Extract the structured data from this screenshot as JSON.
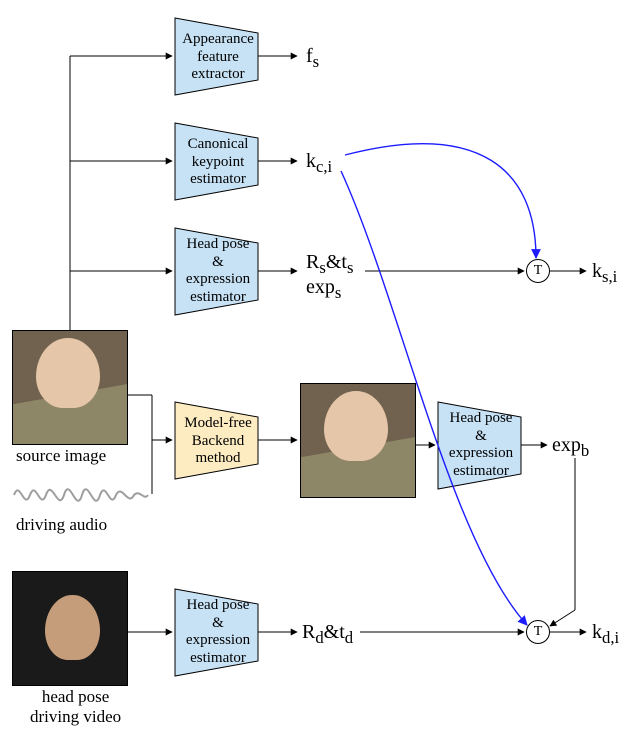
{
  "inputs": {
    "source_image_caption": "source image",
    "driving_audio_caption": "driving audio",
    "head_pose_driving_video_caption": "head pose\ndriving video"
  },
  "modules": {
    "appearance": "Appearance\nfeature\nextractor",
    "canonical": "Canonical\nkeypoint\nestimator",
    "pose_expr_top": "Head pose\n&\nexpression\nestimator",
    "backend": "Model-free\nBackend\nmethod",
    "pose_expr_mid": "Head pose\n&\nexpression\nestimator",
    "pose_expr_bot": "Head pose\n&\nexpression\nestimator"
  },
  "ops": {
    "T1": "T",
    "T2": "T"
  },
  "vars": {
    "fs": "f_s",
    "kci": "k_{c,i}",
    "Rs_ts": "R_s & t_s",
    "exps": "exp_s",
    "expb": "exp_b",
    "Rd_td": "R_d & t_d",
    "ksi": "k_{s,i}",
    "kdi": "k_{d,i}"
  },
  "chart_data": {
    "type": "diagram",
    "title": "",
    "nodes": [
      {
        "id": "source_image",
        "type": "input",
        "label": "source image"
      },
      {
        "id": "driving_audio",
        "type": "input",
        "label": "driving audio"
      },
      {
        "id": "head_pose_video",
        "type": "input",
        "label": "head pose driving video"
      },
      {
        "id": "appearance_extractor",
        "type": "module",
        "label": "Appearance feature extractor",
        "color": "#c7e2f5"
      },
      {
        "id": "canonical_kp",
        "type": "module",
        "label": "Canonical keypoint estimator",
        "color": "#c7e2f5"
      },
      {
        "id": "pose_expr_src",
        "type": "module",
        "label": "Head pose & expression estimator",
        "color": "#c7e2f5"
      },
      {
        "id": "backend",
        "type": "module",
        "label": "Model-free Backend method",
        "color": "#fdecc2"
      },
      {
        "id": "generated_frame",
        "type": "intermediate",
        "label": "generated frame"
      },
      {
        "id": "pose_expr_gen",
        "type": "module",
        "label": "Head pose & expression estimator",
        "color": "#c7e2f5"
      },
      {
        "id": "pose_expr_hpv",
        "type": "module",
        "label": "Head pose & expression estimator",
        "color": "#c7e2f5"
      },
      {
        "id": "T_top",
        "type": "op",
        "label": "T"
      },
      {
        "id": "T_bot",
        "type": "op",
        "label": "T"
      },
      {
        "id": "f_s",
        "type": "var",
        "label": "f_s"
      },
      {
        "id": "k_ci",
        "type": "var",
        "label": "k_{c,i}"
      },
      {
        "id": "Rs_ts",
        "type": "var",
        "label": "R_s & t_s"
      },
      {
        "id": "exp_s",
        "type": "var",
        "label": "exp_s"
      },
      {
        "id": "exp_b",
        "type": "var",
        "label": "exp_b"
      },
      {
        "id": "Rd_td",
        "type": "var",
        "label": "R_d & t_d"
      },
      {
        "id": "k_si",
        "type": "output",
        "label": "k_{s,i}"
      },
      {
        "id": "k_di",
        "type": "output",
        "label": "k_{d,i}"
      }
    ],
    "edges": [
      {
        "from": "source_image",
        "to": "appearance_extractor"
      },
      {
        "from": "source_image",
        "to": "canonical_kp"
      },
      {
        "from": "source_image",
        "to": "pose_expr_src"
      },
      {
        "from": "source_image",
        "to": "backend"
      },
      {
        "from": "driving_audio",
        "to": "backend"
      },
      {
        "from": "appearance_extractor",
        "to": "f_s"
      },
      {
        "from": "canonical_kp",
        "to": "k_ci"
      },
      {
        "from": "pose_expr_src",
        "to": "Rs_ts"
      },
      {
        "from": "pose_expr_src",
        "to": "exp_s"
      },
      {
        "from": "backend",
        "to": "generated_frame"
      },
      {
        "from": "generated_frame",
        "to": "pose_expr_gen"
      },
      {
        "from": "pose_expr_gen",
        "to": "exp_b"
      },
      {
        "from": "head_pose_video",
        "to": "pose_expr_hpv"
      },
      {
        "from": "pose_expr_hpv",
        "to": "Rd_td"
      },
      {
        "from": "k_ci",
        "to": "T_top",
        "color": "blue"
      },
      {
        "from": "Rs_ts",
        "to": "T_top"
      },
      {
        "from": "exp_s",
        "to": "T_top"
      },
      {
        "from": "T_top",
        "to": "k_si"
      },
      {
        "from": "k_ci",
        "to": "T_bot",
        "color": "blue"
      },
      {
        "from": "Rd_td",
        "to": "T_bot"
      },
      {
        "from": "exp_b",
        "to": "T_bot"
      },
      {
        "from": "T_bot",
        "to": "k_di"
      }
    ]
  }
}
